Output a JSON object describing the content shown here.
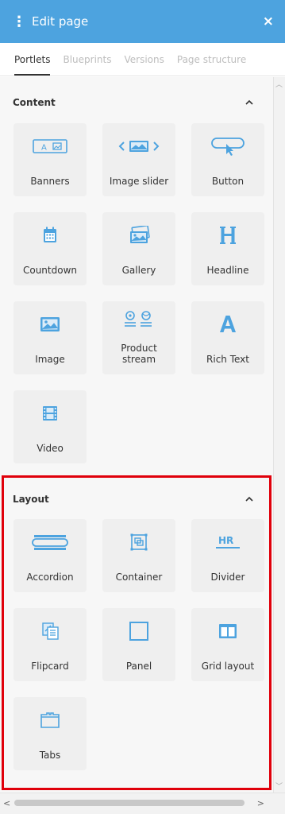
{
  "header": {
    "title": "Edit page",
    "grip": "⋮",
    "close": "×",
    "color": "#4da3df"
  },
  "tabs": [
    {
      "label": "Portlets",
      "active": true
    },
    {
      "label": "Blueprints",
      "active": false
    },
    {
      "label": "Versions",
      "active": false
    },
    {
      "label": "Page structure",
      "active": false
    }
  ],
  "content": {
    "title": "Content",
    "items": [
      {
        "label": "Banners",
        "icon": "banner-icon"
      },
      {
        "label": "Image slider",
        "icon": "image-slider-icon"
      },
      {
        "label": "Button",
        "icon": "button-icon"
      },
      {
        "label": "Countdown",
        "icon": "calendar-icon"
      },
      {
        "label": "Gallery",
        "icon": "gallery-icon"
      },
      {
        "label": "Headline",
        "icon": "headline-icon"
      },
      {
        "label": "Image",
        "icon": "image-icon"
      },
      {
        "label": "Product stream",
        "icon": "product-stream-icon"
      },
      {
        "label": "Rich Text",
        "icon": "rich-text-icon"
      },
      {
        "label": "Video",
        "icon": "film-icon"
      }
    ]
  },
  "layout": {
    "title": "Layout",
    "items": [
      {
        "label": "Accordion",
        "icon": "accordion-icon"
      },
      {
        "label": "Container",
        "icon": "container-icon"
      },
      {
        "label": "Divider",
        "icon": "divider-icon"
      },
      {
        "label": "Flipcard",
        "icon": "flipcard-icon"
      },
      {
        "label": "Panel",
        "icon": "panel-icon"
      },
      {
        "label": "Grid layout",
        "icon": "grid-layout-icon"
      },
      {
        "label": "Tabs",
        "icon": "tabs-icon"
      }
    ]
  },
  "icon_color": "#4da3df",
  "highlight_color": "#e0000b",
  "divider_text": "HR"
}
